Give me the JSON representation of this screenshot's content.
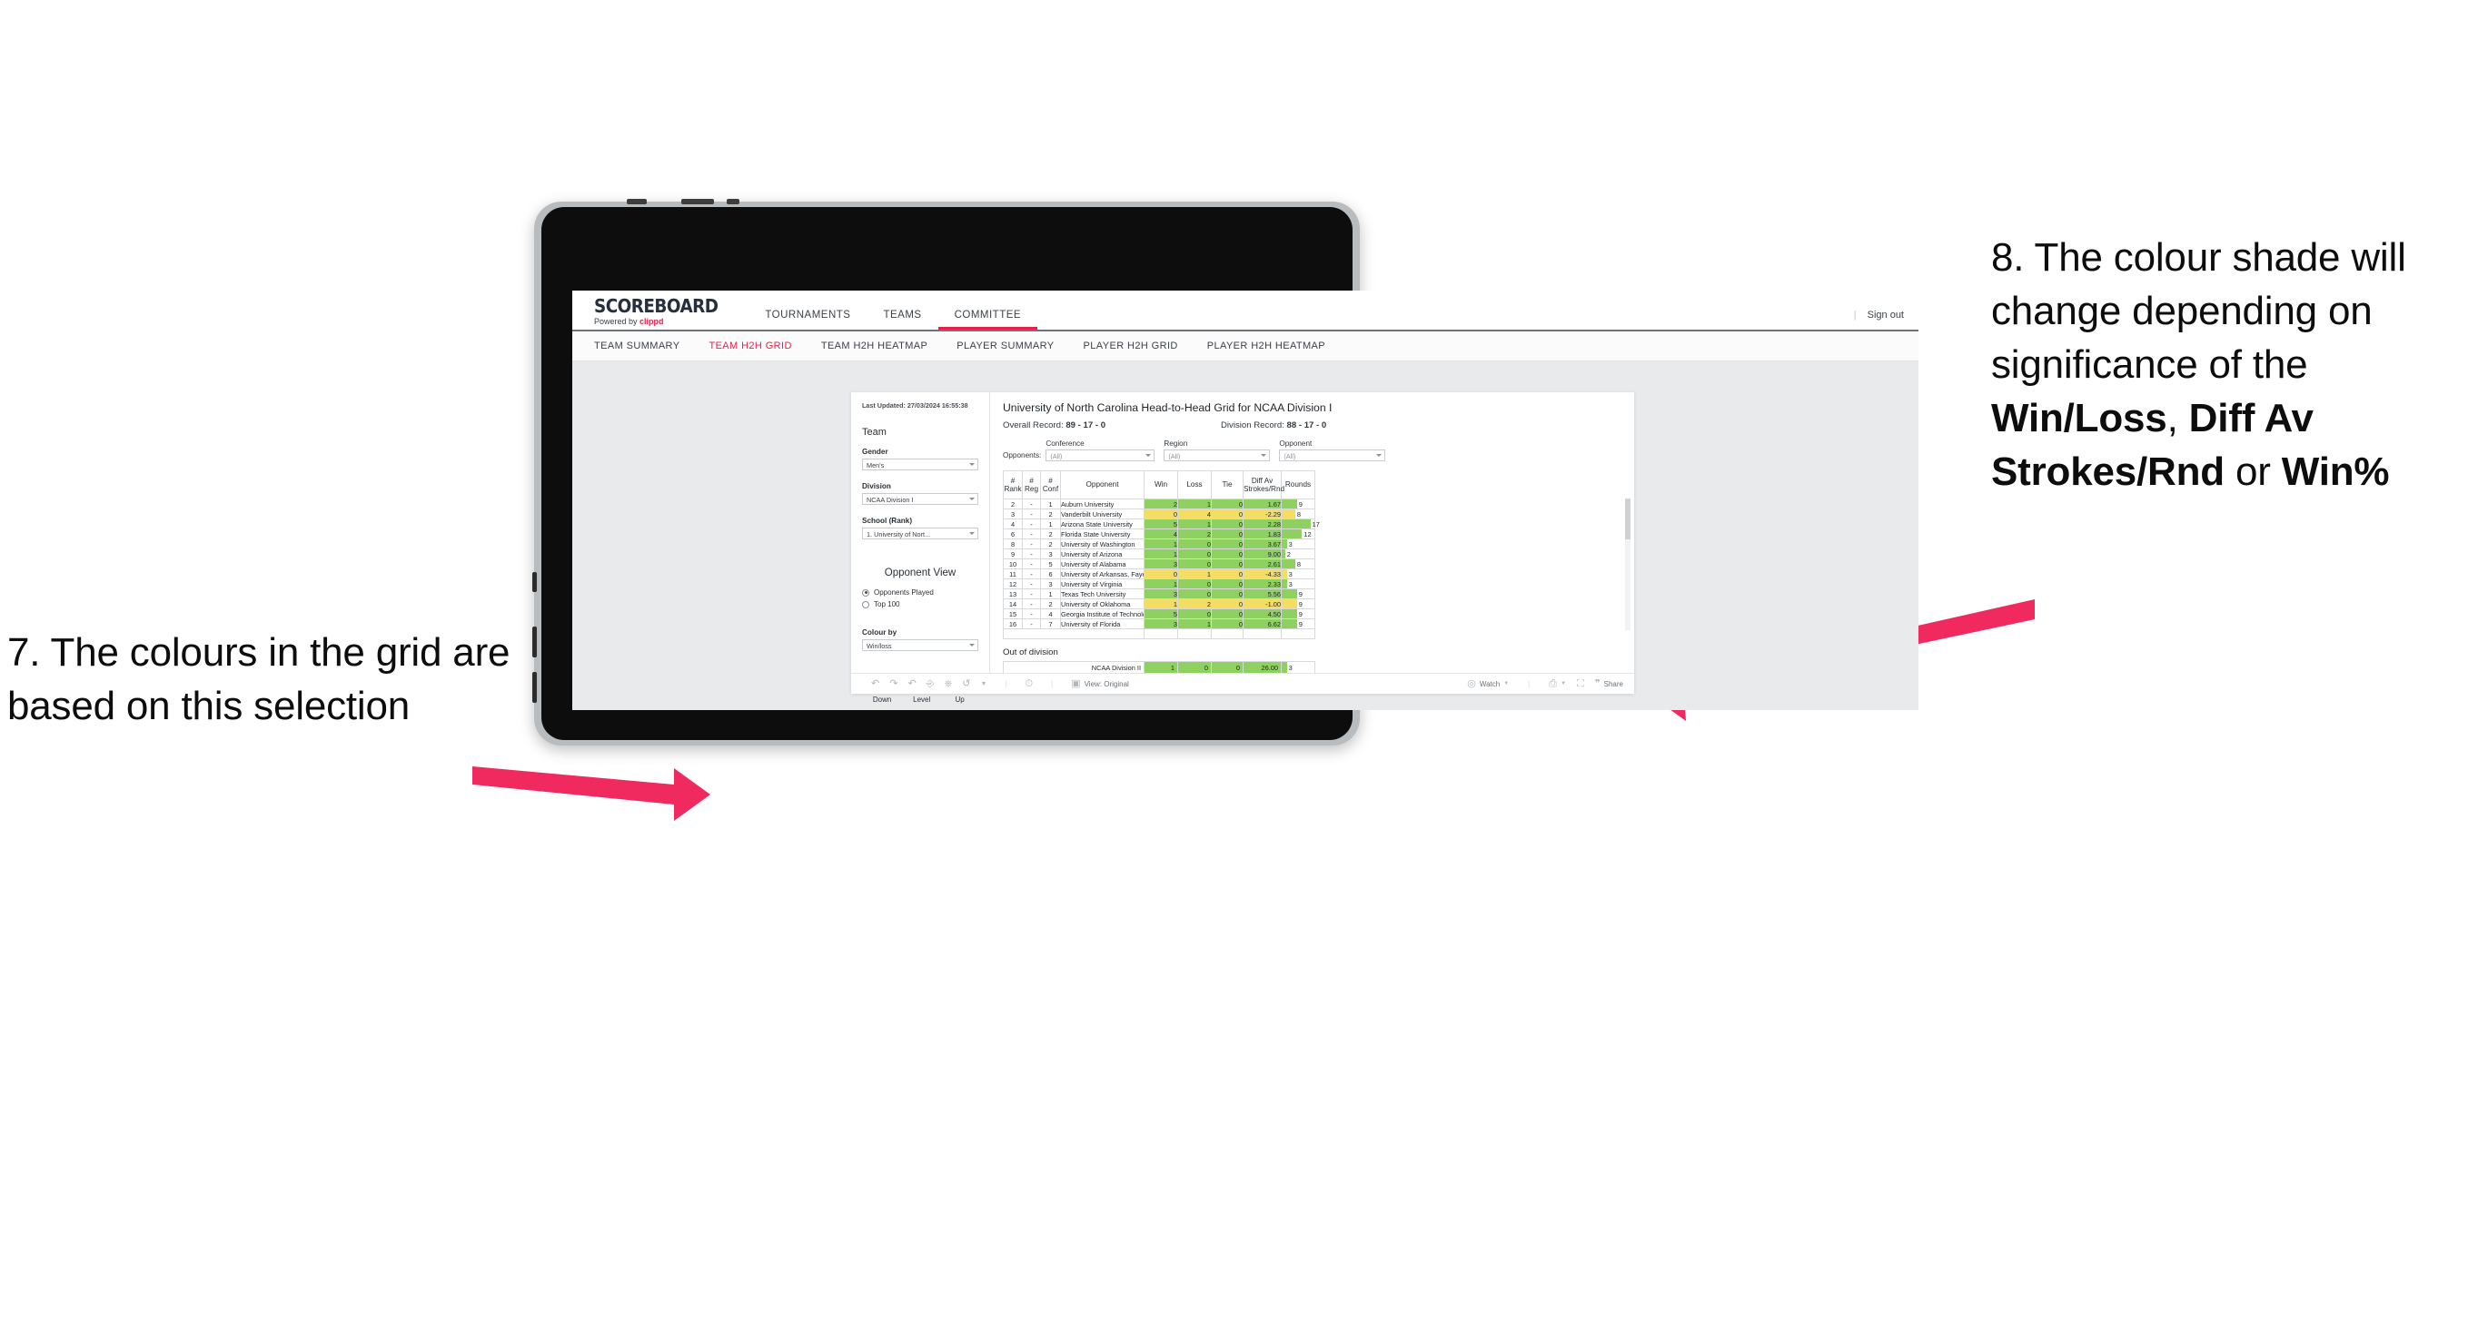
{
  "annotations": {
    "left": {
      "number": "7.",
      "text": "The colours in the grid are based on this selection"
    },
    "right": {
      "number": "8.",
      "lead": "The colour shade will change depending on significance of the ",
      "bold1": "Win/Loss",
      "mid1": ", ",
      "bold2": "Diff Av Strokes/Rnd",
      "mid2": " or ",
      "bold3": "Win%"
    },
    "arrow_color": "#F0295E"
  },
  "app": {
    "brand": {
      "name": "SCOREBOARD",
      "powered_prefix": "Powered by ",
      "powered_by": "clippd"
    },
    "topnav": {
      "tabs": [
        {
          "label": "TOURNAMENTS",
          "active": false
        },
        {
          "label": "TEAMS",
          "active": false
        },
        {
          "label": "COMMITTEE",
          "active": true
        }
      ],
      "signout": "Sign out",
      "divider": "|"
    },
    "subnav": {
      "tabs": [
        {
          "label": "TEAM SUMMARY",
          "active": false
        },
        {
          "label": "TEAM H2H GRID",
          "active": true
        },
        {
          "label": "TEAM H2H HEATMAP",
          "active": false
        },
        {
          "label": "PLAYER SUMMARY",
          "active": false
        },
        {
          "label": "PLAYER H2H GRID",
          "active": false
        },
        {
          "label": "PLAYER H2H HEATMAP",
          "active": false
        }
      ]
    }
  },
  "sidebar": {
    "last_updated_label": "Last Updated: ",
    "last_updated_value": "27/03/2024 16:55:38",
    "team_heading": "Team",
    "gender": {
      "label": "Gender",
      "value": "Men's"
    },
    "division": {
      "label": "Division",
      "value": "NCAA Division I"
    },
    "school": {
      "label": "School (Rank)",
      "value": "1. University of Nort..."
    },
    "opponent_view": {
      "heading": "Opponent View",
      "options": [
        {
          "label": "Opponents Played",
          "selected": true
        },
        {
          "label": "Top 100",
          "selected": false
        }
      ]
    },
    "colour_by": {
      "label": "Colour by",
      "value": "Win/loss"
    },
    "legend": [
      {
        "label": "Down",
        "color": "#F2D44C"
      },
      {
        "label": "Level",
        "color": "#BFC2C6"
      },
      {
        "label": "Up",
        "color": "#8CC63F"
      }
    ]
  },
  "viz": {
    "title": "University of North Carolina Head-to-Head Grid for NCAA Division I",
    "overall_record_label": "Overall Record: ",
    "overall_record_value": "89 - 17 - 0",
    "division_record_label": "Division Record: ",
    "division_record_value": "88 - 17 - 0",
    "opponents_label": "Opponents:",
    "filters": [
      {
        "label": "Conference",
        "value": "(All)"
      },
      {
        "label": "Region",
        "value": "(All)"
      },
      {
        "label": "Opponent",
        "value": "(All)"
      }
    ],
    "out_of_division_title": "Out of division",
    "toolbar": {
      "view_label": "View: Original",
      "watch_label": "Watch",
      "share_label": "Share"
    }
  },
  "chart_data": {
    "type": "table",
    "title": "University of North Carolina Head-to-Head Grid for NCAA Division I",
    "columns": [
      "# Rank",
      "# Reg",
      "# Conf",
      "Opponent",
      "Win",
      "Loss",
      "Tie",
      "Diff Av Strokes/Rnd",
      "Rounds"
    ],
    "column_headers_multiline": [
      [
        "#",
        "Rank"
      ],
      [
        "#",
        "Reg"
      ],
      [
        "#",
        "Conf"
      ],
      [
        "Opponent"
      ],
      [
        "Win"
      ],
      [
        "Loss"
      ],
      [
        "Tie"
      ],
      [
        "Diff Av",
        "Strokes/Rnd"
      ],
      [
        "Rounds"
      ]
    ],
    "colour_by": "Win/loss",
    "colors": {
      "up": "#8FD161",
      "down": "#F5DC62",
      "level": "#BFC2C6",
      "rounds_bar": "#8FD161",
      "rounds_bar_down": "#F5DC62"
    },
    "rounds_max": 17,
    "rows": [
      {
        "rank": "2",
        "reg": "-",
        "conf": "1",
        "opponent": "Auburn University",
        "win": "2",
        "loss": "1",
        "tie": "0",
        "diff": "1.67",
        "rounds": "9",
        "rounds_num": 9,
        "state": "up"
      },
      {
        "rank": "3",
        "reg": "-",
        "conf": "2",
        "opponent": "Vanderbilt University",
        "win": "0",
        "loss": "4",
        "tie": "0",
        "diff": "-2.29",
        "rounds": "8",
        "rounds_num": 8,
        "state": "down"
      },
      {
        "rank": "4",
        "reg": "-",
        "conf": "1",
        "opponent": "Arizona State University",
        "win": "5",
        "loss": "1",
        "tie": "0",
        "diff": "2.28",
        "rounds": "17",
        "rounds_num": 17,
        "state": "up"
      },
      {
        "rank": "6",
        "reg": "-",
        "conf": "2",
        "opponent": "Florida State University",
        "win": "4",
        "loss": "2",
        "tie": "0",
        "diff": "1.83",
        "rounds": "12",
        "rounds_num": 12,
        "state": "up"
      },
      {
        "rank": "8",
        "reg": "-",
        "conf": "2",
        "opponent": "University of Washington",
        "win": "1",
        "loss": "0",
        "tie": "0",
        "diff": "3.67",
        "rounds": "3",
        "rounds_num": 3,
        "state": "up"
      },
      {
        "rank": "9",
        "reg": "-",
        "conf": "3",
        "opponent": "University of Arizona",
        "win": "1",
        "loss": "0",
        "tie": "0",
        "diff": "9.00",
        "rounds": "2",
        "rounds_num": 2,
        "state": "up"
      },
      {
        "rank": "10",
        "reg": "-",
        "conf": "5",
        "opponent": "University of Alabama",
        "win": "3",
        "loss": "0",
        "tie": "0",
        "diff": "2.61",
        "rounds": "8",
        "rounds_num": 8,
        "state": "up"
      },
      {
        "rank": "11",
        "reg": "-",
        "conf": "6",
        "opponent": "University of Arkansas, Fayetteville",
        "win": "0",
        "loss": "1",
        "tie": "0",
        "diff": "-4.33",
        "rounds": "3",
        "rounds_num": 3,
        "state": "down"
      },
      {
        "rank": "12",
        "reg": "-",
        "conf": "3",
        "opponent": "University of Virginia",
        "win": "1",
        "loss": "0",
        "tie": "0",
        "diff": "2.33",
        "rounds": "3",
        "rounds_num": 3,
        "state": "up"
      },
      {
        "rank": "13",
        "reg": "-",
        "conf": "1",
        "opponent": "Texas Tech University",
        "win": "3",
        "loss": "0",
        "tie": "0",
        "diff": "5.56",
        "rounds": "9",
        "rounds_num": 9,
        "state": "up"
      },
      {
        "rank": "14",
        "reg": "-",
        "conf": "2",
        "opponent": "University of Oklahoma",
        "win": "1",
        "loss": "2",
        "tie": "0",
        "diff": "-1.00",
        "rounds": "9",
        "rounds_num": 9,
        "state": "down"
      },
      {
        "rank": "15",
        "reg": "-",
        "conf": "4",
        "opponent": "Georgia Institute of Technology",
        "win": "5",
        "loss": "0",
        "tie": "0",
        "diff": "4.50",
        "rounds": "9",
        "rounds_num": 9,
        "state": "up"
      },
      {
        "rank": "16",
        "reg": "-",
        "conf": "7",
        "opponent": "University of Florida",
        "win": "3",
        "loss": "1",
        "tie": "0",
        "diff": "6.62",
        "rounds": "9",
        "rounds_num": 9,
        "state": "up"
      }
    ],
    "out_of_division": [
      {
        "name": "NCAA Division II",
        "win": "1",
        "loss": "0",
        "tie": "0",
        "diff": "26.00",
        "rounds": "3",
        "rounds_num": 3,
        "state": "up"
      }
    ]
  }
}
